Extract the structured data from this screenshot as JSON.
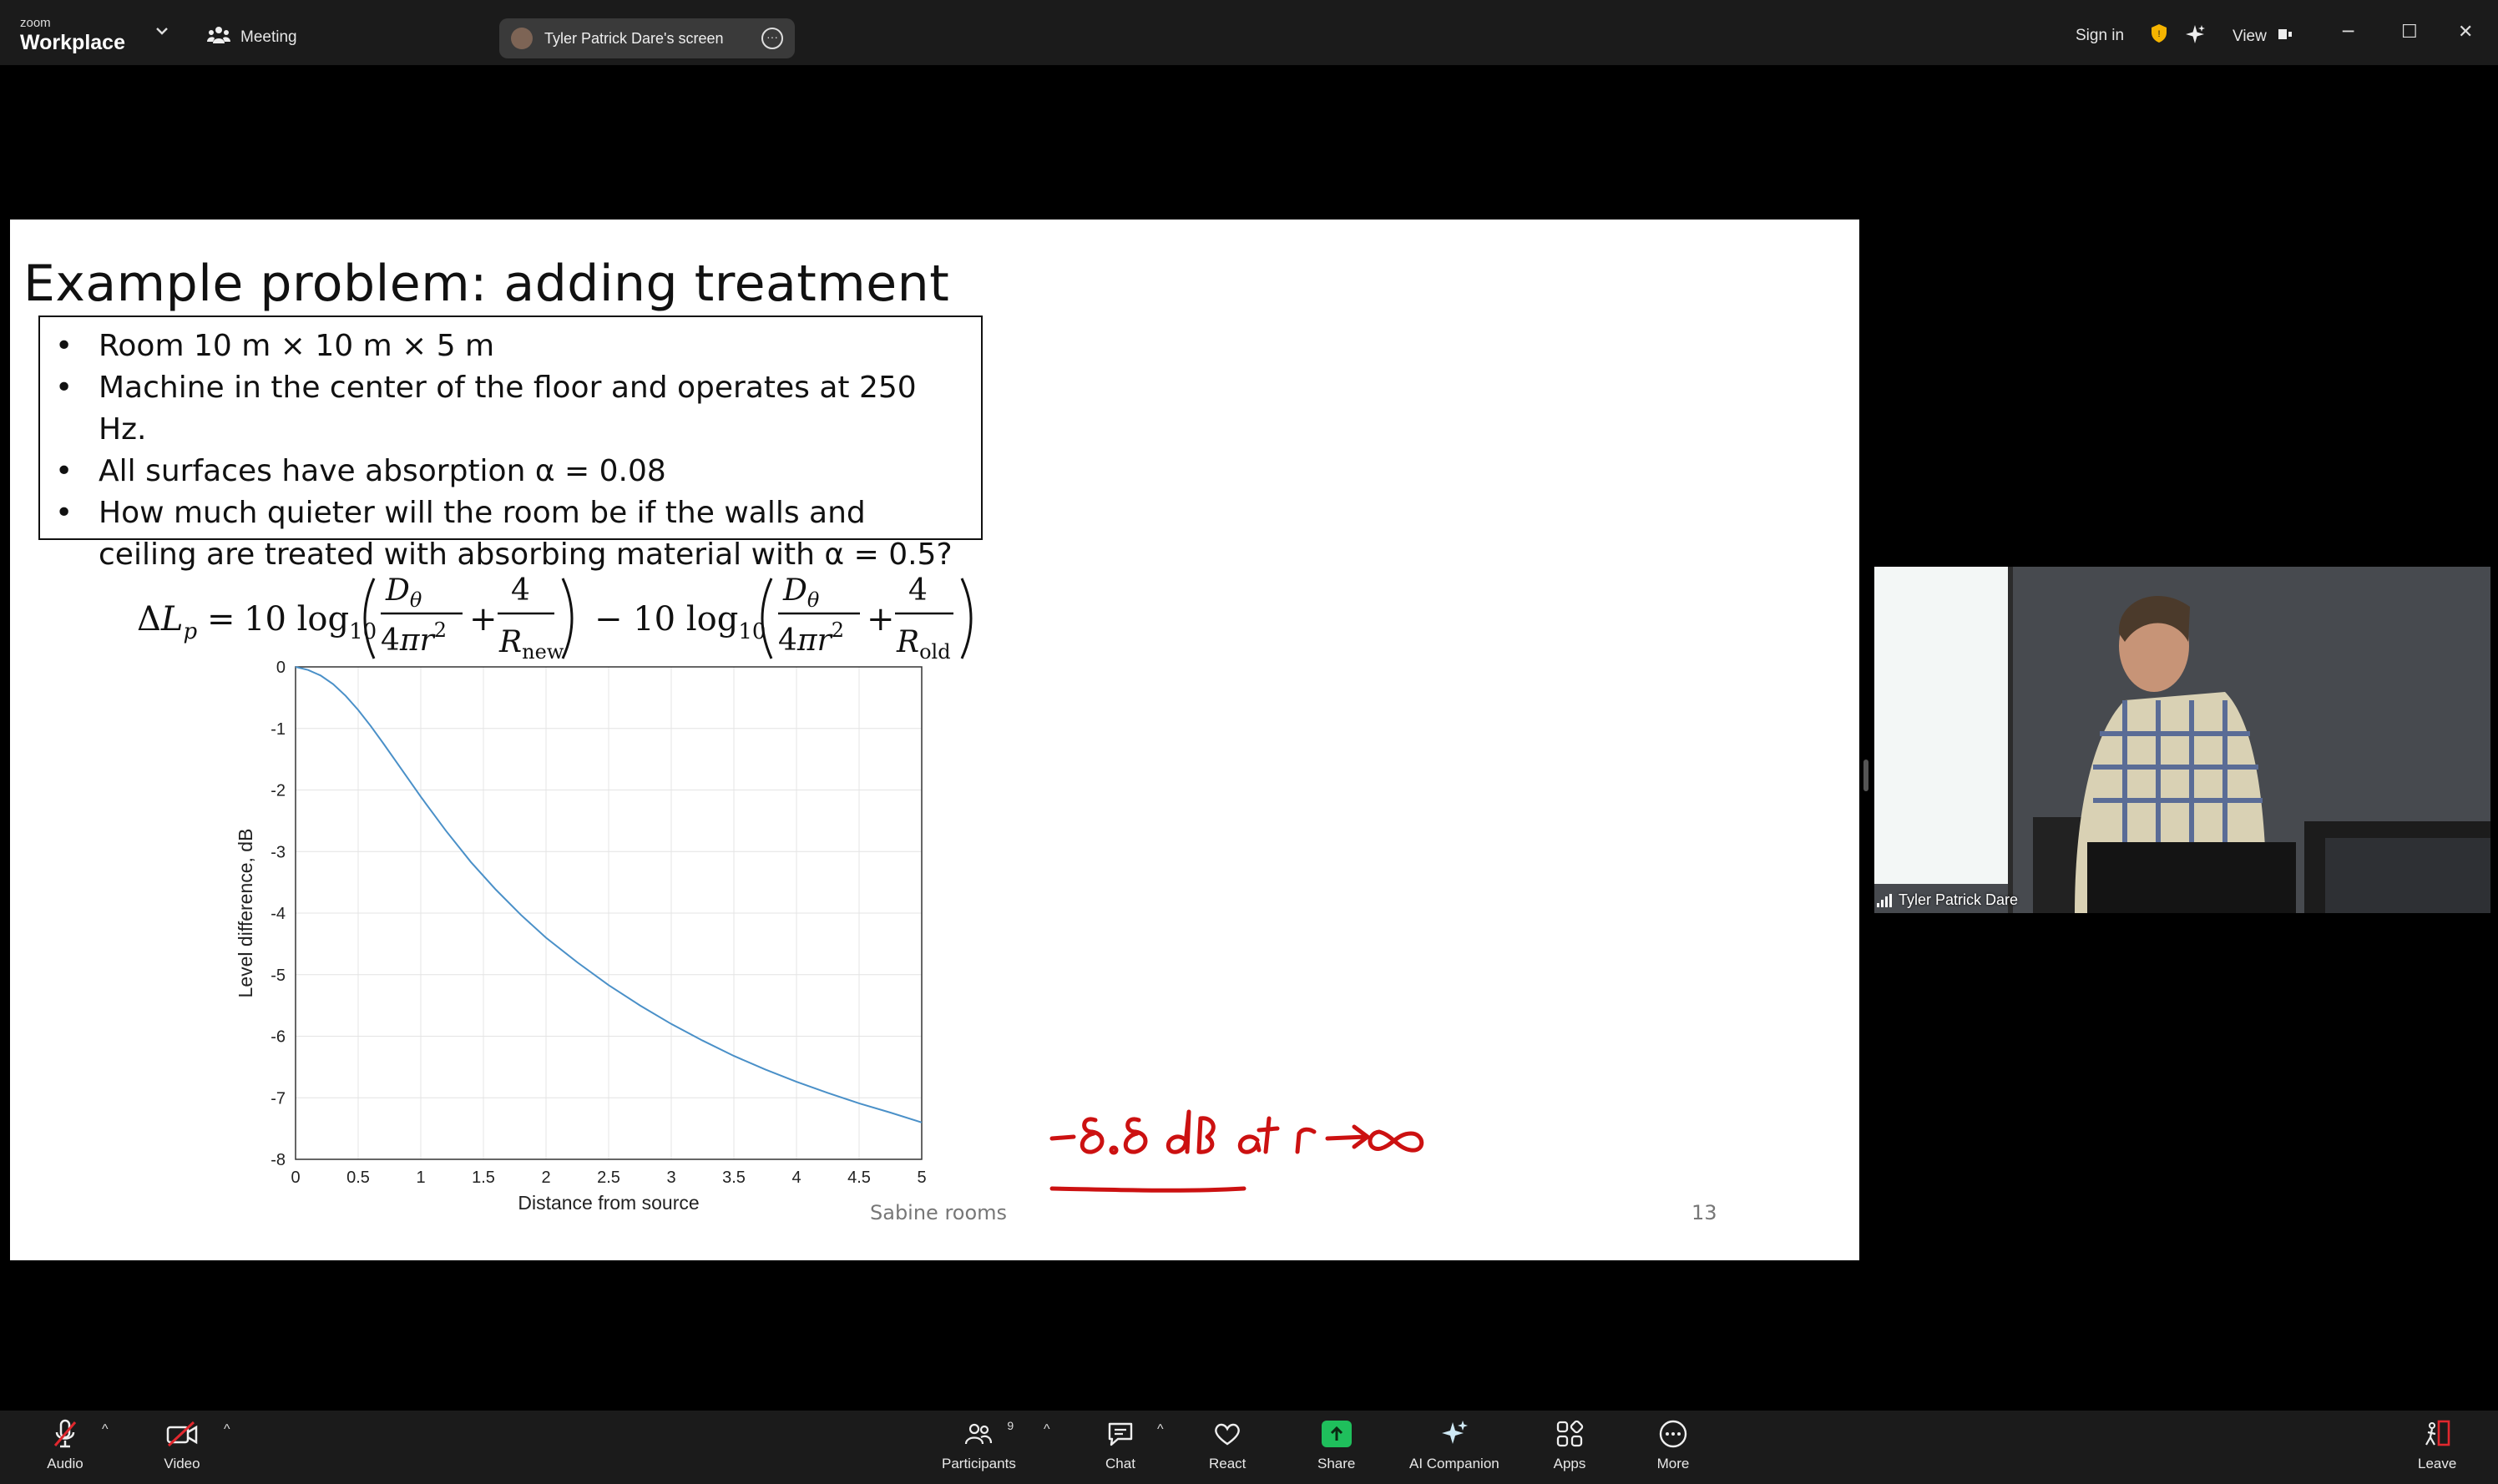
{
  "app": {
    "brand_small": "zoom",
    "brand_big": "Workplace",
    "meeting_label": "Meeting",
    "share_pill_label": "Tyler Patrick Dare's screen",
    "sign_in": "Sign in",
    "view_label": "View"
  },
  "slide": {
    "title": "Example problem: adding treatment",
    "bullets": [
      "Room 10 m × 10 m × 5 m",
      "Machine in the center of the floor and operates at 250 Hz.",
      "All surfaces have absorption α = 0.08",
      "How much quieter will the room be if the walls and ceiling are treated with absorbing material with α = 0.5?"
    ],
    "footer": "Sabine rooms",
    "page_number": "13",
    "annotation": "−8.8 dB at r → ∞"
  },
  "chart_data": {
    "type": "line",
    "xlabel": "Distance from source",
    "ylabel": "Level difference, dB",
    "xlim": [
      0,
      5
    ],
    "ylim": [
      -8,
      0
    ],
    "xticks": [
      "0",
      "0.5",
      "1",
      "1.5",
      "2",
      "2.5",
      "3",
      "3.5",
      "4",
      "4.5",
      "5"
    ],
    "yticks": [
      "0",
      "-1",
      "-2",
      "-3",
      "-4",
      "-5",
      "-6",
      "-7",
      "-8"
    ],
    "grid": true,
    "series": [
      {
        "color": "#4a90c8",
        "x": [
          0,
          0.1,
          0.2,
          0.3,
          0.4,
          0.5,
          0.6,
          0.7,
          0.8,
          0.9,
          1.0,
          1.2,
          1.4,
          1.6,
          1.8,
          2.0,
          2.25,
          2.5,
          2.75,
          3.0,
          3.25,
          3.5,
          3.75,
          4.0,
          4.25,
          4.5,
          4.75,
          5.0
        ],
        "y": [
          0,
          -0.05,
          -0.14,
          -0.28,
          -0.47,
          -0.7,
          -0.96,
          -1.24,
          -1.53,
          -1.82,
          -2.11,
          -2.66,
          -3.17,
          -3.62,
          -4.03,
          -4.4,
          -4.8,
          -5.17,
          -5.5,
          -5.8,
          -6.07,
          -6.32,
          -6.54,
          -6.74,
          -6.92,
          -7.09,
          -7.24,
          -7.4
        ]
      }
    ]
  },
  "video": {
    "participant_name": "Tyler Patrick Dare"
  },
  "toolbar": {
    "audio": "Audio",
    "video": "Video",
    "participants": "Participants",
    "participant_count": "9",
    "chat": "Chat",
    "react": "React",
    "share": "Share",
    "ai_companion": "AI Companion",
    "apps": "Apps",
    "more": "More",
    "leave": "Leave"
  },
  "colors": {
    "toolbar_bg": "#1b1b1b",
    "share_green": "#1fbf5c",
    "annotation_red": "#cc1111",
    "leave_red": "#e0282e",
    "shield_yellow": "#f5b400"
  }
}
